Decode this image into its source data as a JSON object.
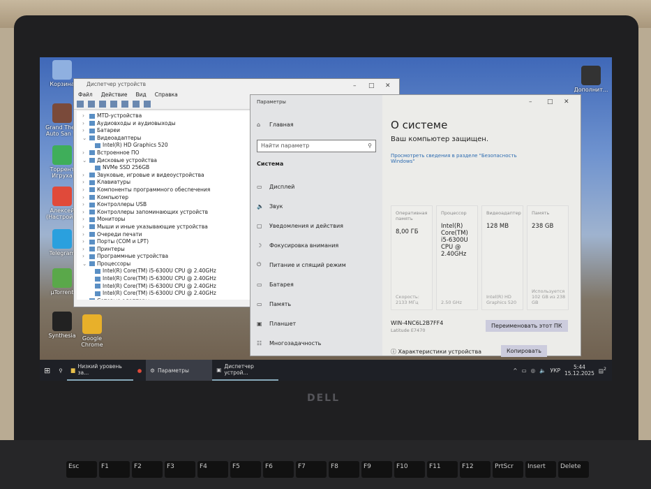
{
  "desktop": {
    "icons": [
      {
        "label": "Корзина",
        "color": "#8fb0e0"
      },
      {
        "label": "Grand Theft Auto San ...",
        "color": "#7a4a3a"
      },
      {
        "label": "Торрент Игруха",
        "color": "#3fae5a"
      },
      {
        "label": "Алексей (Настрой...",
        "color": "#e04a3a"
      },
      {
        "label": "Telegram",
        "color": "#2aa0de"
      },
      {
        "label": "µTorrent",
        "color": "#5aa84a"
      },
      {
        "label": "Synthesia",
        "color": "#222"
      },
      {
        "label": "Google Chrome",
        "color": "#e8b02a"
      },
      {
        "label": "Дополнит...",
        "color": "#333"
      }
    ]
  },
  "device_manager": {
    "title": "Диспетчер устройств",
    "menu": [
      "Файл",
      "Действие",
      "Вид",
      "Справка"
    ],
    "tree": [
      {
        "label": "MTD-устройства",
        "state": "collapsed"
      },
      {
        "label": "Аудиовходы и аудиовыходы",
        "state": "collapsed"
      },
      {
        "label": "Батареи",
        "state": "collapsed"
      },
      {
        "label": "Видеоадаптеры",
        "state": "expanded"
      },
      {
        "label": "Intel(R) HD Graphics 520",
        "state": "child"
      },
      {
        "label": "Встроенное ПО",
        "state": "collapsed"
      },
      {
        "label": "Дисковые устройства",
        "state": "expanded"
      },
      {
        "label": "NVMe SSD 256GB",
        "state": "child"
      },
      {
        "label": "Звуковые, игровые и видеоустройства",
        "state": "collapsed"
      },
      {
        "label": "Клавиатуры",
        "state": "collapsed"
      },
      {
        "label": "Компоненты программного обеспечения",
        "state": "collapsed"
      },
      {
        "label": "Компьютер",
        "state": "collapsed"
      },
      {
        "label": "Контроллеры USB",
        "state": "collapsed"
      },
      {
        "label": "Контроллеры запоминающих устройств",
        "state": "collapsed"
      },
      {
        "label": "Мониторы",
        "state": "collapsed"
      },
      {
        "label": "Мыши и иные указывающие устройства",
        "state": "collapsed"
      },
      {
        "label": "Очереди печати",
        "state": "collapsed"
      },
      {
        "label": "Порты (COM и LPT)",
        "state": "collapsed"
      },
      {
        "label": "Принтеры",
        "state": "collapsed"
      },
      {
        "label": "Программные устройства",
        "state": "collapsed"
      },
      {
        "label": "Процессоры",
        "state": "expanded"
      },
      {
        "label": "Intel(R) Core(TM) i5-6300U CPU @ 2.40GHz",
        "state": "child"
      },
      {
        "label": "Intel(R) Core(TM) i5-6300U CPU @ 2.40GHz",
        "state": "child"
      },
      {
        "label": "Intel(R) Core(TM) i5-6300U CPU @ 2.40GHz",
        "state": "child"
      },
      {
        "label": "Intel(R) Core(TM) i5-6300U CPU @ 2.40GHz",
        "state": "child"
      },
      {
        "label": "Сетевые адаптеры",
        "state": "collapsed"
      }
    ]
  },
  "settings": {
    "title": "Параметры",
    "home": "Главная",
    "search_placeholder": "Найти параметр",
    "section": "Система",
    "nav": [
      {
        "label": "Дисплей",
        "icon": "▭"
      },
      {
        "label": "Звук",
        "icon": "🔈"
      },
      {
        "label": "Уведомления и действия",
        "icon": "▢"
      },
      {
        "label": "Фокусировка внимания",
        "icon": "☽"
      },
      {
        "label": "Питание и спящий режим",
        "icon": "⏻"
      },
      {
        "label": "Батарея",
        "icon": "▭"
      },
      {
        "label": "Память",
        "icon": "▭"
      },
      {
        "label": "Планшет",
        "icon": "▣"
      },
      {
        "label": "Многозадачность",
        "icon": "☷"
      }
    ],
    "heading": "О системе",
    "protected": "Ваш компьютер защищен.",
    "security_link": "Просмотреть сведения в разделе \"Безопасность Windows\"",
    "cards": [
      {
        "label": "Оперативная память",
        "value": "8,00 ГБ",
        "sub": "Скорость: 2133 МГц"
      },
      {
        "label": "Процессор",
        "value": "Intel(R) Core(TM) i5-6300U CPU @ 2.40GHz",
        "sub": "2.50 GHz"
      },
      {
        "label": "Видеоадаптер",
        "value": "128 MB",
        "sub": "Intel(R) HD Graphics 520"
      },
      {
        "label": "Память",
        "value": "238 GB",
        "sub": "Используется 102 GB из 238 GB"
      }
    ],
    "pc_name": "WIN-4NC6L2B7FF4",
    "model": "Latitude E7470",
    "rename_button": "Переименовать этот ПК",
    "specs_label": "Характеристики устройства",
    "copy_button": "Копировать"
  },
  "taskbar": {
    "items": [
      "Низкий уровень за...",
      "Параметры",
      "Диспетчер устрой..."
    ],
    "lang": "УКР",
    "time": "5:44",
    "date": "15.12.2025",
    "notifications": "2"
  },
  "laptop": {
    "brand": "DELL",
    "keys": [
      "Esc",
      "F1",
      "F2",
      "F3",
      "F4",
      "F5",
      "F6",
      "F7",
      "F8",
      "F9",
      "F10",
      "F11",
      "F12",
      "PrtScr",
      "Insert",
      "Delete"
    ]
  }
}
